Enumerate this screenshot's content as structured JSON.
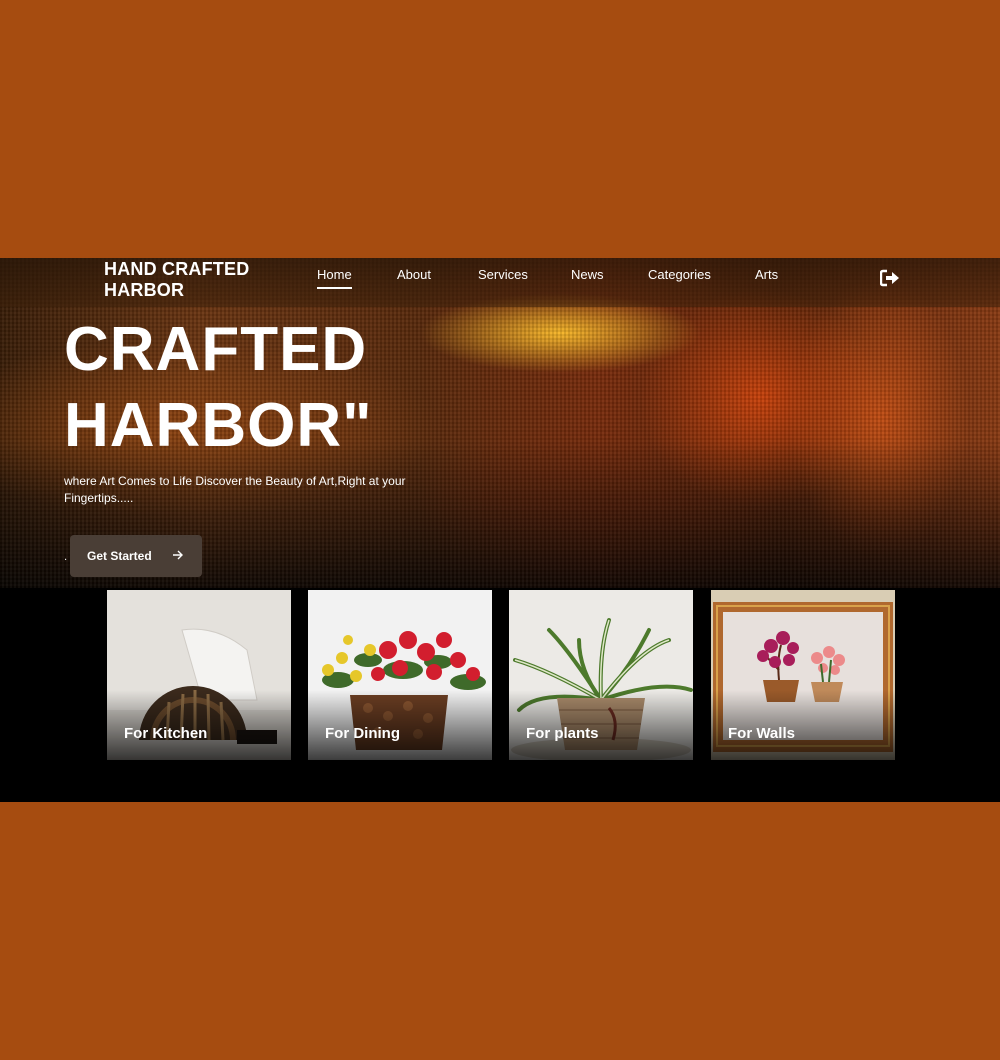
{
  "brand": {
    "line1": "HAND CRAFTED",
    "line2": "HARBOR"
  },
  "nav": {
    "items": [
      "Home",
      "About",
      "Services",
      "News",
      "Categories",
      "Arts"
    ],
    "active": "Home",
    "logout_icon": "sign-out-icon"
  },
  "hero": {
    "title_line1": "CRAFTED",
    "title_line2": "HARBOR\"",
    "description": "where Art Comes to Life Discover the Beauty of Art,Right at your Fingertips.....",
    "dot": ".",
    "cta_label": "Get Started",
    "cta_icon": "arrow-right-icon"
  },
  "categories": [
    {
      "label": "For Kitchen"
    },
    {
      "label": "For Dining"
    },
    {
      "label": "For plants"
    },
    {
      "label": "For Walls"
    }
  ],
  "colors": {
    "page_bg": "#a64c10",
    "cta_bg": "#4a3e36",
    "text": "#ffffff"
  }
}
